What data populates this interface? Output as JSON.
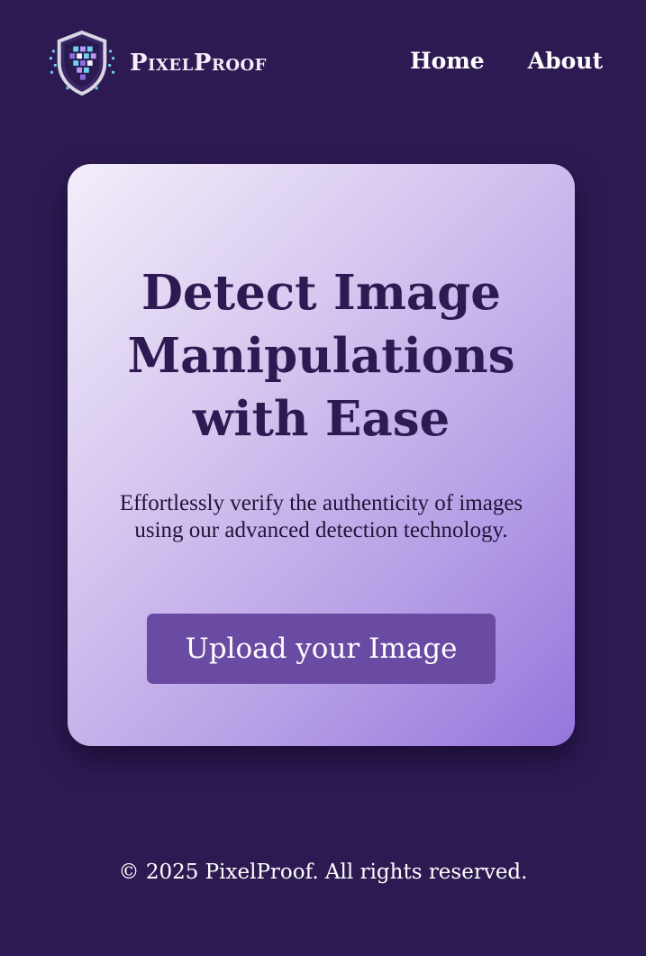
{
  "brand": {
    "name": "PixelProof",
    "logo_icon": "shield-pixel-icon"
  },
  "nav": {
    "home": "Home",
    "about": "About"
  },
  "hero": {
    "title": "Detect Image Manipulations with Ease",
    "description": "Effortlessly verify the authenticity of images using our advanced detection technology.",
    "button_label": "Upload your Image"
  },
  "footer": {
    "text": "© 2025 PixelProof. All rights reserved."
  },
  "colors": {
    "background": "#2d1a52",
    "card_gradient_start": "#f3eefa",
    "card_gradient_end": "#9575dc",
    "button": "#6a4ba3",
    "heading": "#2d1a52"
  }
}
